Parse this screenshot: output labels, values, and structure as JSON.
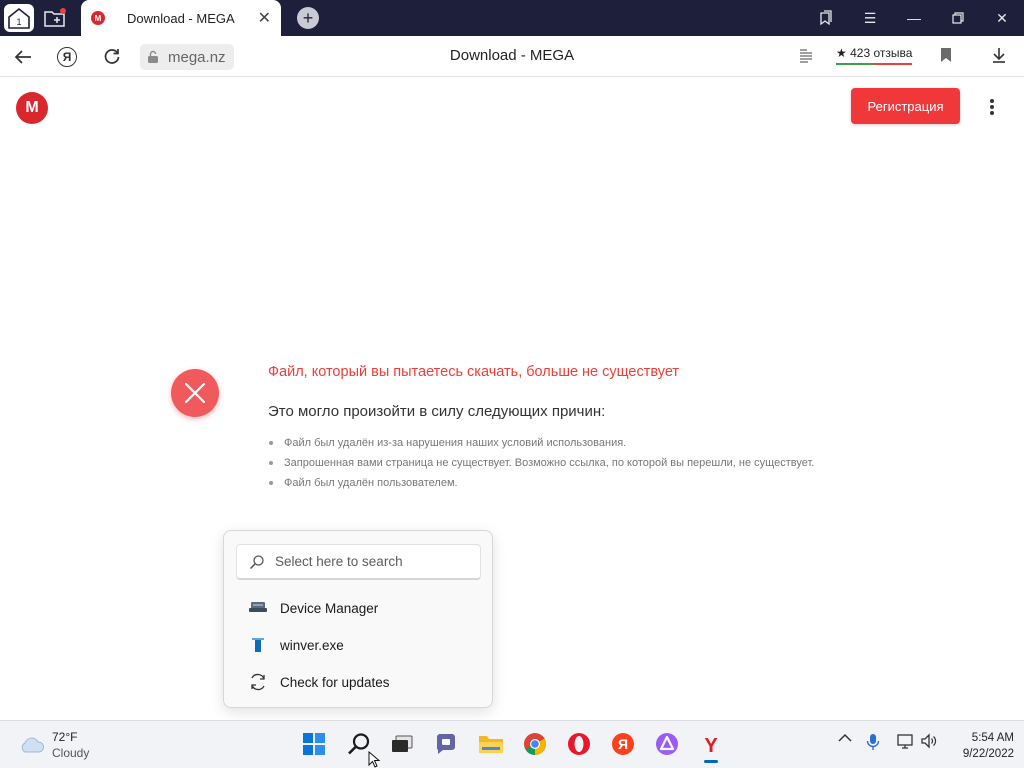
{
  "browser": {
    "tab": {
      "title": "Download - MEGA",
      "favicon_letter": "M"
    },
    "home_badge": "1",
    "address": {
      "domain": "mega.nz",
      "page_title": "Download - MEGA"
    },
    "reviews": {
      "stars": "★",
      "label": "423 отзыва"
    }
  },
  "page": {
    "logo_letter": "M",
    "register_label": "Регистрация",
    "error": {
      "title": "Файл, который вы пытаетесь скачать, больше не существует",
      "subtitle": "Это могло произойти в силу следующих причин:",
      "reasons": [
        "Файл был удалён из-за нарушения наших условий использования.",
        "Запрошенная вами страница не существует. Возможно ссылка, по которой вы перешли, не существует.",
        "Файл был удалён пользователем."
      ]
    }
  },
  "search_popup": {
    "placeholder": "Select here to search",
    "items": [
      {
        "label": "Device Manager",
        "icon": "device-manager-icon"
      },
      {
        "label": "winver.exe",
        "icon": "exe-file-icon"
      },
      {
        "label": "Check for updates",
        "icon": "refresh-icon"
      }
    ]
  },
  "taskbar": {
    "weather": {
      "temp": "72°F",
      "condition": "Cloudy"
    },
    "apps": [
      "start",
      "search",
      "task-view",
      "chat",
      "file-explorer",
      "chrome",
      "opera",
      "yandex",
      "alice",
      "yandex-browser"
    ],
    "clock": {
      "time": "5:54 AM",
      "date": "9/22/2022"
    }
  },
  "colors": {
    "mega_red": "#d9272e",
    "register_red": "#f0373a",
    "error_red": "#e8403a",
    "tabstrip": "#1e1f3a"
  }
}
